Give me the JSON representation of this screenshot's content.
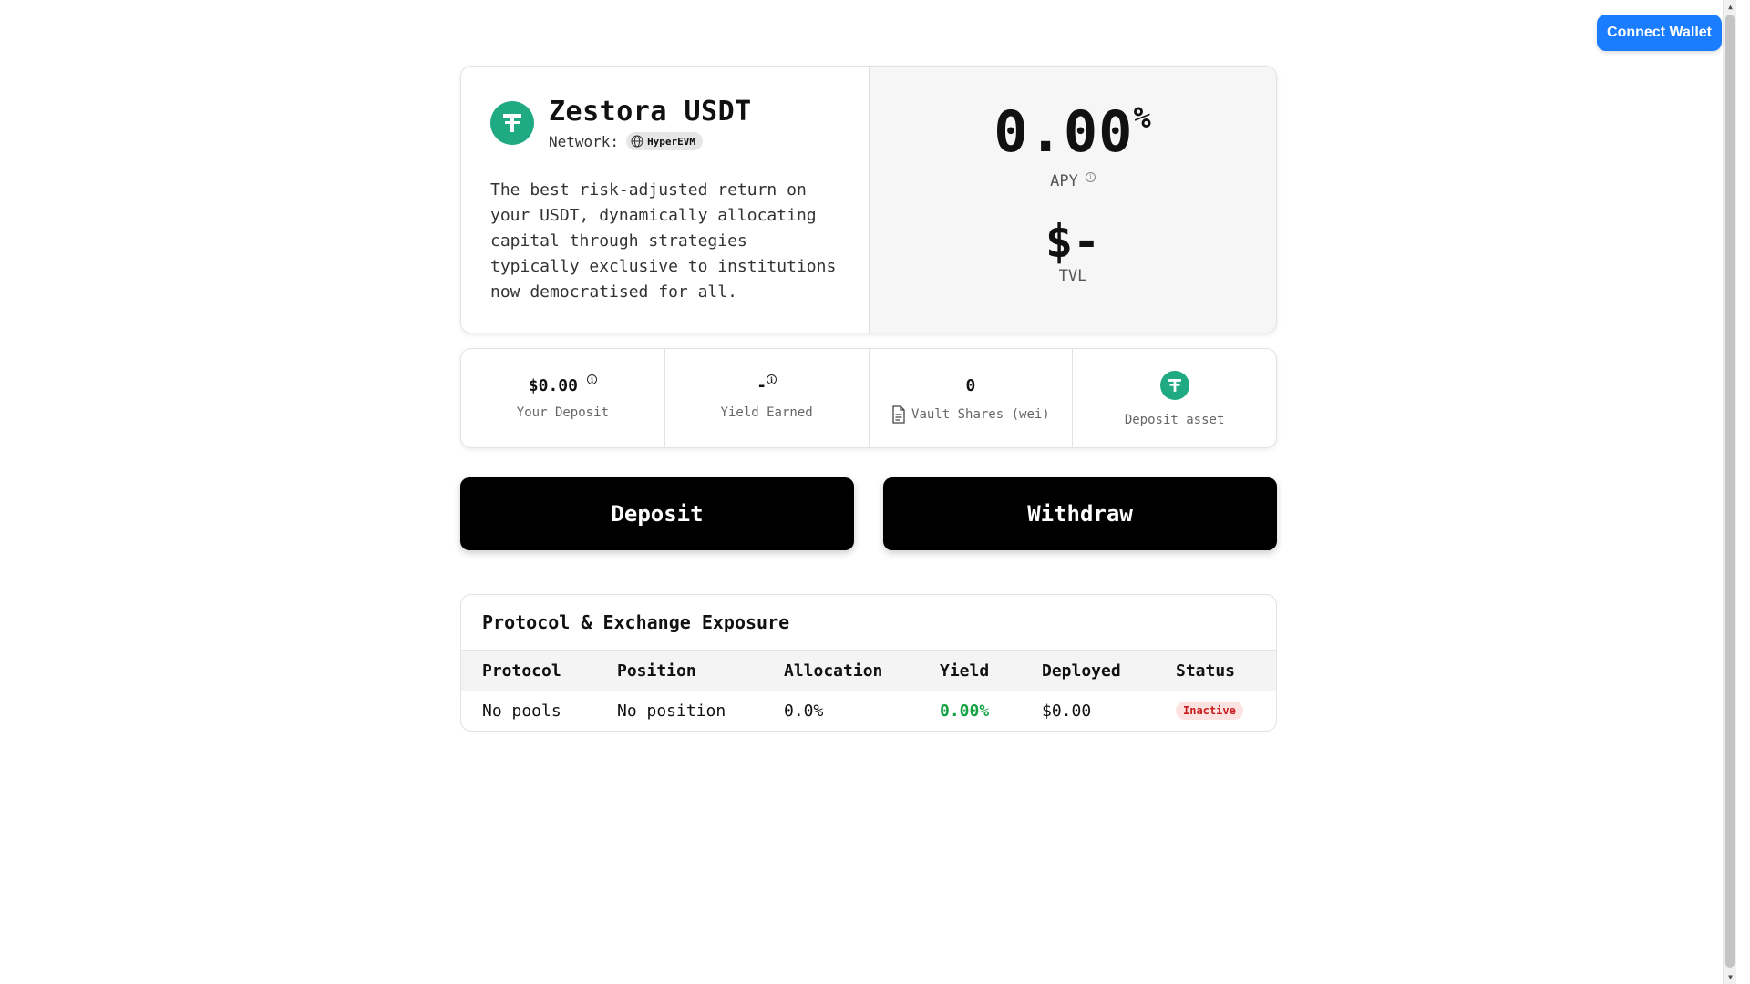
{
  "header": {
    "connect_wallet_label": "Connect Wallet"
  },
  "vault": {
    "name": "Zestora USDT",
    "network_label": "Network:",
    "network_name": "HyperEVM",
    "description": "The best risk-adjusted return on your USDT, dynamically allocating capital through strategies typically exclusive to institutions now democratised for all."
  },
  "stats": {
    "apy_value": "0.00",
    "apy_suffix": "%",
    "apy_label": "APY",
    "tvl_value": "$-",
    "tvl_label": "TVL"
  },
  "metrics": {
    "deposit_value": "$0.00",
    "deposit_label": "Your Deposit",
    "yield_value": "-",
    "yield_label": "Yield Earned",
    "shares_value": "0",
    "shares_label": "Vault Shares (wei)",
    "asset_label": "Deposit asset"
  },
  "actions": {
    "deposit_label": "Deposit",
    "withdraw_label": "Withdraw"
  },
  "exposure": {
    "title": "Protocol & Exchange Exposure",
    "columns": [
      "Protocol",
      "Position",
      "Allocation",
      "Yield",
      "Deployed",
      "Status"
    ],
    "rows": [
      {
        "protocol": "No pools",
        "position": "No position",
        "allocation": "0.0%",
        "yield": "0.00%",
        "deployed": "$0.00",
        "status": "Inactive"
      }
    ]
  },
  "colors": {
    "accent": "#1a7cff",
    "token_green": "#1faa83",
    "yield_green": "#13a342",
    "inactive_red": "#c91d1d"
  },
  "icons": [
    "usdt-logo-icon",
    "globe-icon",
    "info-icon",
    "document-icon"
  ]
}
